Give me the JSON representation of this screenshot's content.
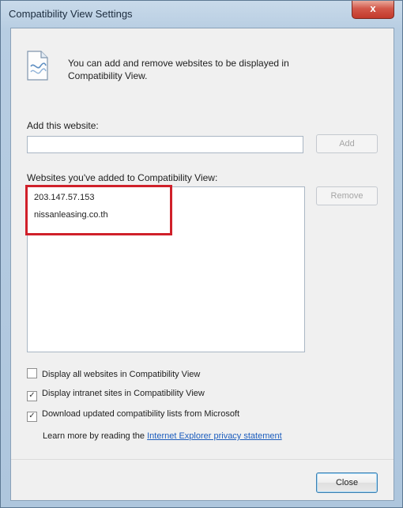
{
  "window": {
    "title": "Compatibility View Settings",
    "close_glyph": "x"
  },
  "info": {
    "icon": "compatibility-view-icon",
    "text": "You can add and remove websites to be displayed in Compatibility View."
  },
  "add_site": {
    "label": "Add this website:",
    "value": "",
    "add_button": "Add"
  },
  "site_list": {
    "label": "Websites you've added to Compatibility View:",
    "items": [
      "203.147.57.153",
      "nissanleasing.co.th"
    ],
    "remove_button": "Remove"
  },
  "options": [
    {
      "label": "Display all websites in Compatibility View",
      "checked": false
    },
    {
      "label": "Display intranet sites in Compatibility View",
      "checked": true
    },
    {
      "label": "Download updated compatibility lists from Microsoft",
      "checked": true
    }
  ],
  "learn_more": {
    "prefix": "Learn more by reading the ",
    "link": "Internet Explorer privacy statement"
  },
  "close_button": "Close",
  "annotation_color": "#d0202a"
}
